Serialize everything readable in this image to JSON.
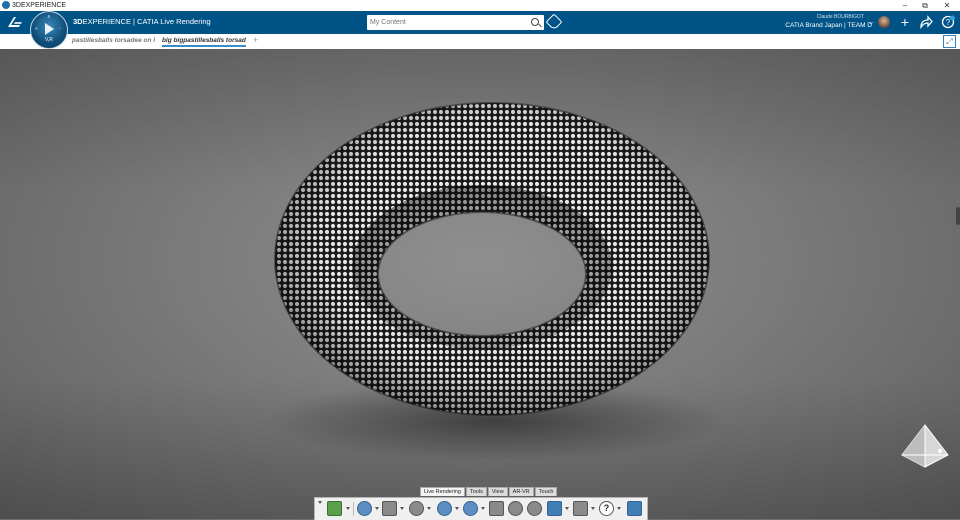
{
  "window": {
    "title": "3DEXPERIENCE",
    "minimize": "–",
    "restore": "⧉",
    "close": "✕"
  },
  "header": {
    "brand_bold": "3D",
    "brand_rest": "EXPERIENCE | CATIA Live Rendering",
    "compass_label": "V,R",
    "search_placeholder": "My Content",
    "user_name": "Claude BOURBIGOT",
    "user_org": "CATIA Brand Japan | TEAM D",
    "icons": [
      "3ds-logo",
      "compass-icon",
      "search-icon",
      "tag-icon",
      "avatar",
      "add-icon",
      "share-icon",
      "help-icon"
    ]
  },
  "tabs": [
    {
      "label": "pastillesballs torsadee on l",
      "active": false
    },
    {
      "label": "big bigpastillesballs torsad",
      "active": true
    }
  ],
  "tab_add": "+",
  "action_bar": {
    "tabs": [
      {
        "label": "Live Rendering",
        "active": true
      },
      {
        "label": "Tools",
        "active": false
      },
      {
        "label": "View",
        "active": false
      },
      {
        "label": "AR-VR",
        "active": false
      },
      {
        "label": "Touch",
        "active": false
      }
    ],
    "help_glyph": "?",
    "icons": [
      "render-icon",
      "environment-icon",
      "stage-icon",
      "materials-icon",
      "visibility-icon",
      "camera-icon",
      "capture-icon",
      "refresh-icon",
      "settings-icon",
      "display-icon",
      "options-icon",
      "help-icon",
      "texture-icon"
    ]
  },
  "colors": {
    "header_blue": "#005386",
    "tab_underline": "#3a8cc8",
    "torus_light": "#eaeaea",
    "torus_dark": "#1a1a1a"
  }
}
